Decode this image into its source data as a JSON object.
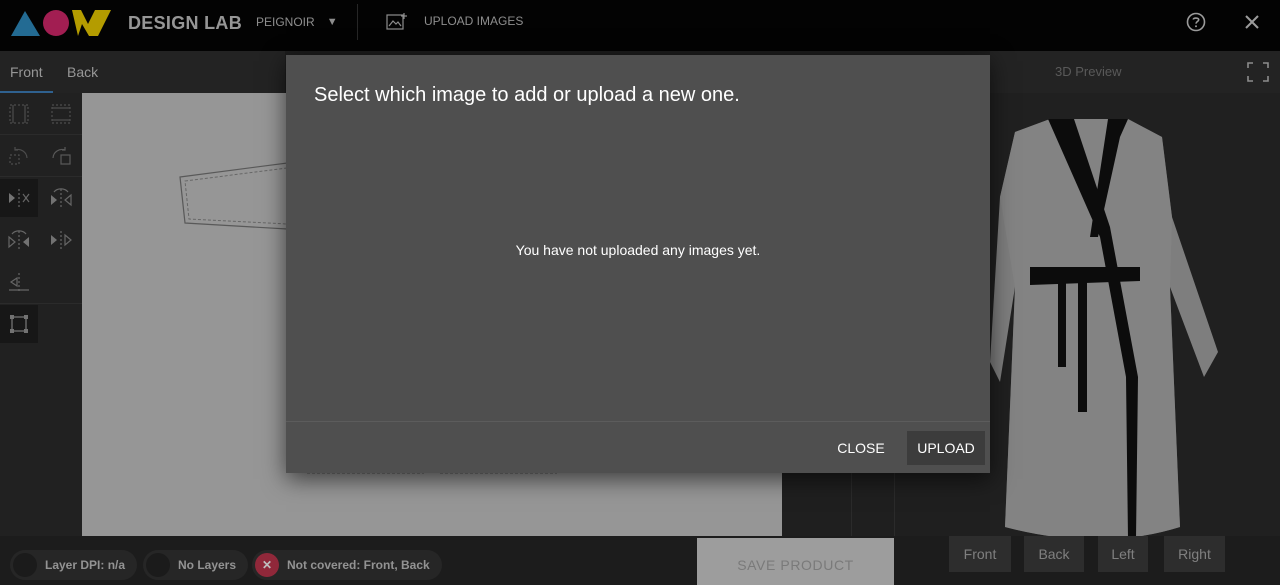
{
  "app": {
    "brand": "DESIGN LAB",
    "product": "PEIGNOIR",
    "upload_images_label": "UPLOAD IMAGES"
  },
  "tabs": [
    {
      "label": "Front",
      "active": true
    },
    {
      "label": "Back",
      "active": false
    }
  ],
  "preview": {
    "title": "3D Preview",
    "buttons": [
      "Front",
      "Back",
      "Left",
      "Right"
    ]
  },
  "status": {
    "dpi": "Layer DPI: n/a",
    "layers": "No Layers",
    "coverage": "Not covered: Front, Back"
  },
  "save_label": "SAVE PRODUCT",
  "dialog": {
    "title": "Select which image to add or upload a new one.",
    "message": "You have not uploaded any images yet.",
    "close_label": "CLOSE",
    "upload_label": "UPLOAD"
  },
  "colors": {
    "logo_triangle": "#2f8fc4",
    "logo_circle": "#d8286e",
    "logo_w": "#f0d000",
    "tab_underline": "#3f82bf",
    "coverage_alert": "#c0364e"
  },
  "icons": {
    "product_caret": "caret-down-icon",
    "upload_images": "image-plus-icon",
    "help": "help-circle-icon",
    "close_app": "close-icon",
    "fullscreen": "fullscreen-icon",
    "coverage_alert": "x-circle-icon"
  }
}
